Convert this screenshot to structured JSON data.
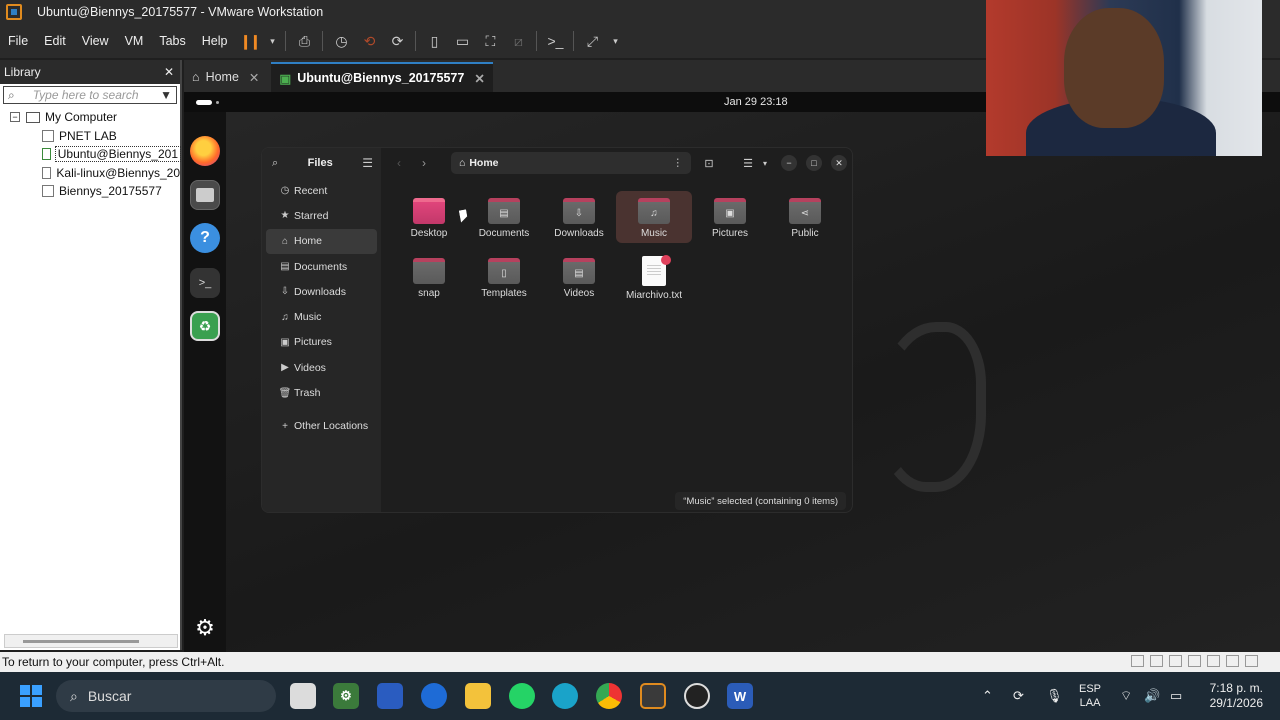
{
  "window": {
    "title": "Ubuntu@Biennys_20175577 - VMware Workstation"
  },
  "menu": {
    "items": [
      "File",
      "Edit",
      "View",
      "VM",
      "Tabs",
      "Help"
    ]
  },
  "library": {
    "title": "Library",
    "search_placeholder": "Type here to search",
    "root": "My Computer",
    "items": [
      "PNET LAB",
      "Ubuntu@Biennys_201",
      "Kali-linux@Biennys_20",
      "Biennys_20175577"
    ]
  },
  "tabs": [
    {
      "label": "Home"
    },
    {
      "label": "Ubuntu@Biennys_20175577"
    }
  ],
  "guest": {
    "clock": "Jan 29  23:18",
    "files": {
      "title": "Files",
      "path": "Home",
      "sidebar": [
        "Recent",
        "Starred",
        "Home",
        "Documents",
        "Downloads",
        "Music",
        "Pictures",
        "Videos",
        "Trash",
        "Other Locations"
      ],
      "items": [
        "Desktop",
        "Documents",
        "Downloads",
        "Music",
        "Pictures",
        "Public",
        "snap",
        "Templates",
        "Videos",
        "Miarchivo.txt"
      ],
      "status": "“Music” selected  (containing 0 items)"
    }
  },
  "status_bar": {
    "text": "To return to your computer, press Ctrl+Alt."
  },
  "taskbar": {
    "search": "Buscar",
    "lang": [
      "ESP",
      "LAA"
    ],
    "time": "7:18 p. m.",
    "date": "29/1/2026"
  },
  "colors": {
    "accent": "#2f7fc4",
    "pause": "#f08a24",
    "folder_tab": "#b6415e",
    "selection": "#4a3330"
  }
}
